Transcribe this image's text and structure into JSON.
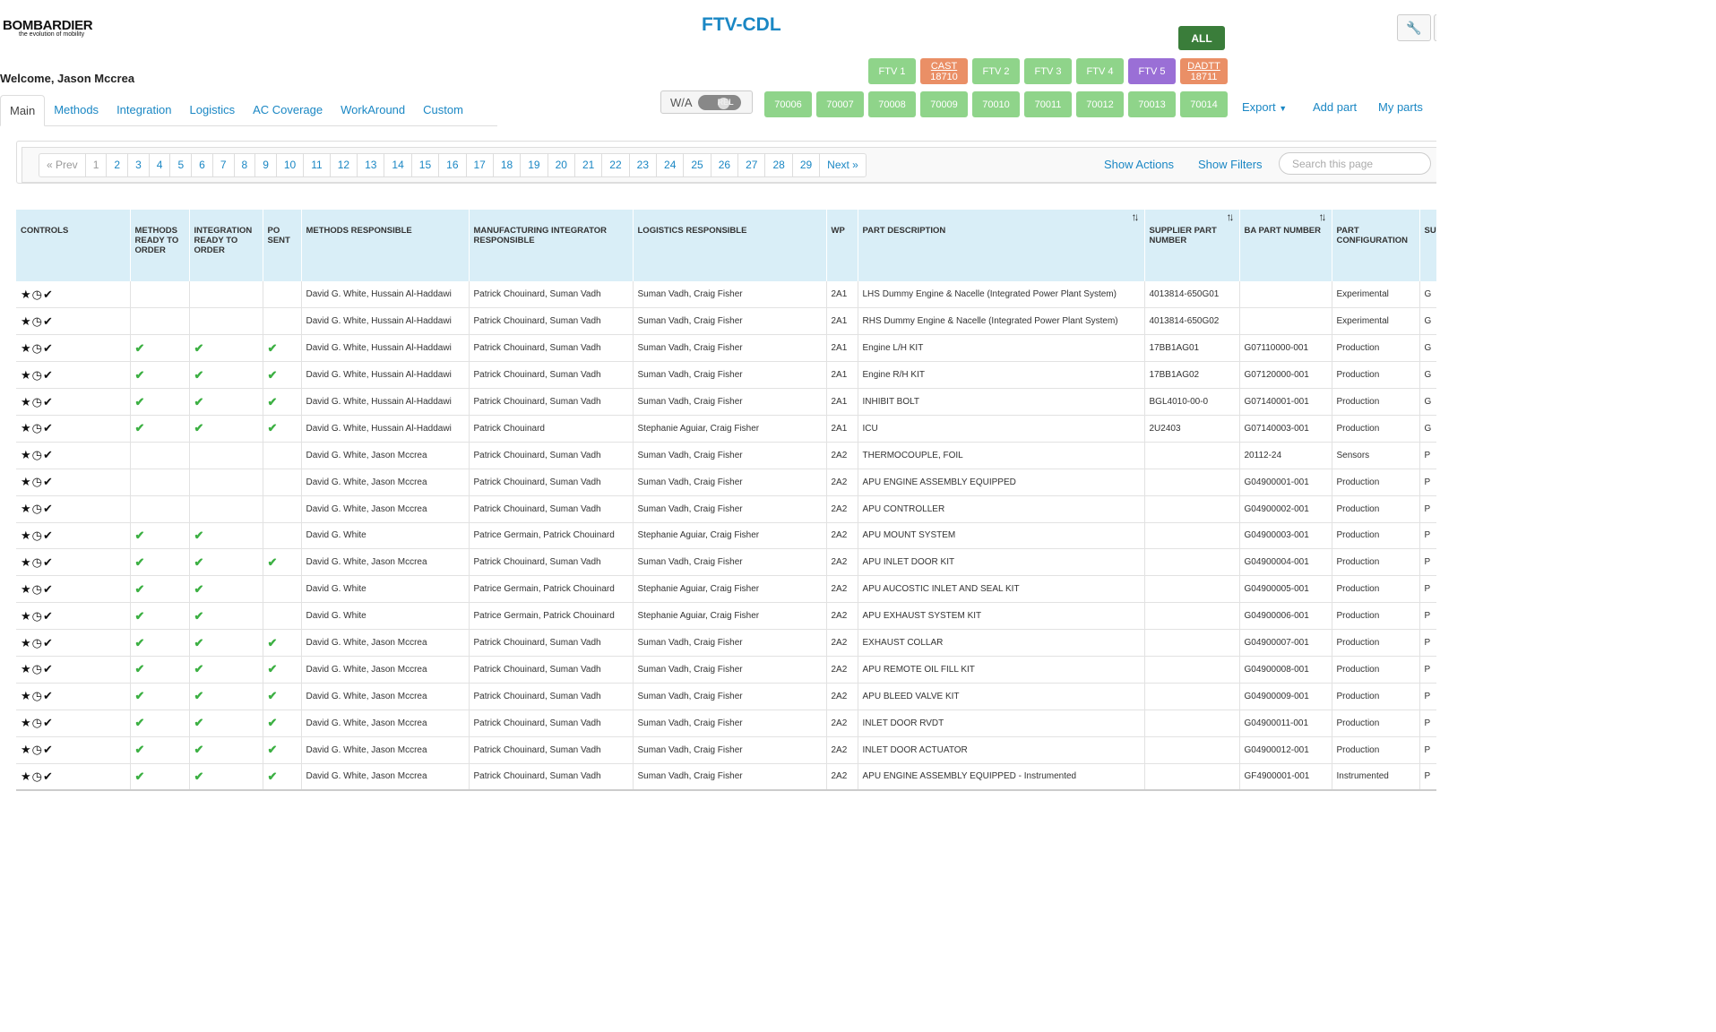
{
  "header": {
    "brand": "BOMBARDIER",
    "tagline": "the evolution of mobility",
    "title": "FTV-CDL",
    "welcome": "Welcome, Jason Mccrea",
    "all_label": "ALL",
    "wrench_icon": "wrench-icon"
  },
  "ftv_buttons": [
    {
      "label": "FTV 1",
      "sub": "",
      "color": "green"
    },
    {
      "label": "CAST",
      "sub": "18710",
      "color": "orange"
    },
    {
      "label": "FTV 2",
      "sub": "",
      "color": "green"
    },
    {
      "label": "FTV 3",
      "sub": "",
      "color": "green"
    },
    {
      "label": "FTV 4",
      "sub": "",
      "color": "green"
    },
    {
      "label": "FTV 5",
      "sub": "",
      "color": "purple"
    },
    {
      "label": "DADTT",
      "sub": "18711",
      "color": "orange"
    }
  ],
  "aircraft_buttons": [
    "70006",
    "70007",
    "70008",
    "70009",
    "70010",
    "70011",
    "70012",
    "70013",
    "70014"
  ],
  "toggle": {
    "label": "W/A",
    "state": "REL"
  },
  "top_actions": {
    "export": "Export",
    "add_part": "Add part",
    "my_parts": "My parts"
  },
  "tabs": [
    "Main",
    "Methods",
    "Integration",
    "Logistics",
    "AC Coverage",
    "WorkAround",
    "Custom"
  ],
  "active_tab": "Main",
  "pagination": {
    "prev": "« Prev",
    "pages": [
      "1",
      "2",
      "3",
      "4",
      "5",
      "6",
      "7",
      "8",
      "9",
      "10",
      "11",
      "12",
      "13",
      "14",
      "15",
      "16",
      "17",
      "18",
      "19",
      "20",
      "21",
      "22",
      "23",
      "24",
      "25",
      "26",
      "27",
      "28",
      "29"
    ],
    "next": "Next »"
  },
  "toolbar": {
    "show_actions": "Show Actions",
    "show_filters": "Show Filters",
    "search_placeholder": "Search this page"
  },
  "columns": [
    "CONTROLS",
    "METHODS READY TO ORDER",
    "INTEGRATION READY TO ORDER",
    "PO SENT",
    "METHODS RESPONSIBLE",
    "MANUFACTURING INTEGRATOR RESPONSIBLE",
    "LOGISTICS RESPONSIBLE",
    "WP",
    "PART DESCRIPTION",
    "SUPPLIER PART NUMBER",
    "BA PART NUMBER",
    "PART CONFIGURATION",
    "SU"
  ],
  "control_icons": [
    "star-icon",
    "clock-icon",
    "check-icon"
  ],
  "rows": [
    {
      "m": false,
      "i": false,
      "po": false,
      "mr": "David G. White, Hussain Al-Haddawi",
      "mir": "Patrick Chouinard, Suman Vadh",
      "lr": "Suman Vadh, Craig Fisher",
      "wp": "2A1",
      "desc": "LHS Dummy Engine & Nacelle (Integrated Power Plant System)",
      "spn": "4013814-650G01",
      "ba": "",
      "cfg": "Experimental",
      "su": "G"
    },
    {
      "m": false,
      "i": false,
      "po": false,
      "mr": "David G. White, Hussain Al-Haddawi",
      "mir": "Patrick Chouinard, Suman Vadh",
      "lr": "Suman Vadh, Craig Fisher",
      "wp": "2A1",
      "desc": "RHS Dummy Engine & Nacelle (Integrated Power Plant System)",
      "spn": "4013814-650G02",
      "ba": "",
      "cfg": "Experimental",
      "su": "G"
    },
    {
      "m": true,
      "i": true,
      "po": true,
      "mr": "David G. White, Hussain Al-Haddawi",
      "mir": "Patrick Chouinard, Suman Vadh",
      "lr": "Suman Vadh, Craig Fisher",
      "wp": "2A1",
      "desc": "Engine L/H KIT",
      "spn": "17BB1AG01",
      "ba": "G07110000-001",
      "cfg": "Production",
      "su": "G"
    },
    {
      "m": true,
      "i": true,
      "po": true,
      "mr": "David G. White, Hussain Al-Haddawi",
      "mir": "Patrick Chouinard, Suman Vadh",
      "lr": "Suman Vadh, Craig Fisher",
      "wp": "2A1",
      "desc": "Engine R/H KIT",
      "spn": "17BB1AG02",
      "ba": "G07120000-001",
      "cfg": "Production",
      "su": "G"
    },
    {
      "m": true,
      "i": true,
      "po": true,
      "mr": "David G. White, Hussain Al-Haddawi",
      "mir": "Patrick Chouinard, Suman Vadh",
      "lr": "Suman Vadh, Craig Fisher",
      "wp": "2A1",
      "desc": "INHIBIT BOLT",
      "spn": "BGL4010-00-0",
      "ba": "G07140001-001",
      "cfg": "Production",
      "su": "G"
    },
    {
      "m": true,
      "i": true,
      "po": true,
      "mr": "David G. White, Hussain Al-Haddawi",
      "mir": "Patrick Chouinard",
      "lr": "Stephanie Aguiar, Craig Fisher",
      "wp": "2A1",
      "desc": "ICU",
      "spn": "2U2403",
      "ba": "G07140003-001",
      "cfg": "Production",
      "su": "G"
    },
    {
      "m": false,
      "i": false,
      "po": false,
      "mr": "David G. White, Jason Mccrea",
      "mir": "Patrick Chouinard, Suman Vadh",
      "lr": "Suman Vadh, Craig Fisher",
      "wp": "2A2",
      "desc": "THERMOCOUPLE, FOIL",
      "spn": "",
      "ba": "20112-24",
      "cfg": "Sensors",
      "su": "P"
    },
    {
      "m": false,
      "i": false,
      "po": false,
      "mr": "David G. White, Jason Mccrea",
      "mir": "Patrick Chouinard, Suman Vadh",
      "lr": "Suman Vadh, Craig Fisher",
      "wp": "2A2",
      "desc": "APU ENGINE ASSEMBLY EQUIPPED",
      "spn": "",
      "ba": "G04900001-001",
      "cfg": "Production",
      "su": "P"
    },
    {
      "m": false,
      "i": false,
      "po": false,
      "mr": "David G. White, Jason Mccrea",
      "mir": "Patrick Chouinard, Suman Vadh",
      "lr": "Suman Vadh, Craig Fisher",
      "wp": "2A2",
      "desc": "APU CONTROLLER",
      "spn": "",
      "ba": "G04900002-001",
      "cfg": "Production",
      "su": "P"
    },
    {
      "m": true,
      "i": true,
      "po": false,
      "mr": "David G. White",
      "mir": "Patrice Germain, Patrick Chouinard",
      "lr": "Stephanie Aguiar, Craig Fisher",
      "wp": "2A2",
      "desc": "APU MOUNT SYSTEM",
      "spn": "",
      "ba": "G04900003-001",
      "cfg": "Production",
      "su": "P"
    },
    {
      "m": true,
      "i": true,
      "po": true,
      "mr": "David G. White, Jason Mccrea",
      "mir": "Patrick Chouinard, Suman Vadh",
      "lr": "Suman Vadh, Craig Fisher",
      "wp": "2A2",
      "desc": "APU INLET DOOR KIT",
      "spn": "",
      "ba": "G04900004-001",
      "cfg": "Production",
      "su": "P"
    },
    {
      "m": true,
      "i": true,
      "po": false,
      "mr": "David G. White",
      "mir": "Patrice Germain, Patrick Chouinard",
      "lr": "Stephanie Aguiar, Craig Fisher",
      "wp": "2A2",
      "desc": "APU AUCOSTIC INLET AND SEAL KIT",
      "spn": "",
      "ba": "G04900005-001",
      "cfg": "Production",
      "su": "P"
    },
    {
      "m": true,
      "i": true,
      "po": false,
      "mr": "David G. White",
      "mir": "Patrice Germain, Patrick Chouinard",
      "lr": "Stephanie Aguiar, Craig Fisher",
      "wp": "2A2",
      "desc": "APU EXHAUST SYSTEM KIT",
      "spn": "",
      "ba": "G04900006-001",
      "cfg": "Production",
      "su": "P"
    },
    {
      "m": true,
      "i": true,
      "po": true,
      "mr": "David G. White, Jason Mccrea",
      "mir": "Patrick Chouinard, Suman Vadh",
      "lr": "Suman Vadh, Craig Fisher",
      "wp": "2A2",
      "desc": "EXHAUST COLLAR",
      "spn": "",
      "ba": "G04900007-001",
      "cfg": "Production",
      "su": "P"
    },
    {
      "m": true,
      "i": true,
      "po": true,
      "mr": "David G. White, Jason Mccrea",
      "mir": "Patrick Chouinard, Suman Vadh",
      "lr": "Suman Vadh, Craig Fisher",
      "wp": "2A2",
      "desc": "APU REMOTE OIL FILL KIT",
      "spn": "",
      "ba": "G04900008-001",
      "cfg": "Production",
      "su": "P"
    },
    {
      "m": true,
      "i": true,
      "po": true,
      "mr": "David G. White, Jason Mccrea",
      "mir": "Patrick Chouinard, Suman Vadh",
      "lr": "Suman Vadh, Craig Fisher",
      "wp": "2A2",
      "desc": "APU BLEED VALVE KIT",
      "spn": "",
      "ba": "G04900009-001",
      "cfg": "Production",
      "su": "P"
    },
    {
      "m": true,
      "i": true,
      "po": true,
      "mr": "David G. White, Jason Mccrea",
      "mir": "Patrick Chouinard, Suman Vadh",
      "lr": "Suman Vadh, Craig Fisher",
      "wp": "2A2",
      "desc": "INLET DOOR RVDT",
      "spn": "",
      "ba": "G04900011-001",
      "cfg": "Production",
      "su": "P"
    },
    {
      "m": true,
      "i": true,
      "po": true,
      "mr": "David G. White, Jason Mccrea",
      "mir": "Patrick Chouinard, Suman Vadh",
      "lr": "Suman Vadh, Craig Fisher",
      "wp": "2A2",
      "desc": "INLET DOOR ACTUATOR",
      "spn": "",
      "ba": "G04900012-001",
      "cfg": "Production",
      "su": "P"
    },
    {
      "m": true,
      "i": true,
      "po": true,
      "mr": "David G. White, Jason Mccrea",
      "mir": "Patrick Chouinard, Suman Vadh",
      "lr": "Suman Vadh, Craig Fisher",
      "wp": "2A2",
      "desc": "APU ENGINE ASSEMBLY EQUIPPED - Instrumented",
      "spn": "",
      "ba": "GF4900001-001",
      "cfg": "Instrumented",
      "su": "P"
    }
  ]
}
